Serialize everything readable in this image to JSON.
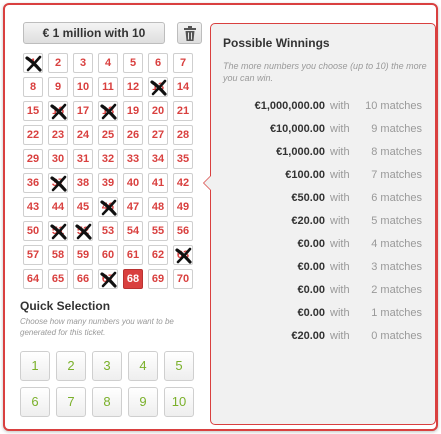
{
  "stake_button": {
    "label": "€ 1 million with 10"
  },
  "icons": {
    "trash": "trash-icon",
    "selected_mark": "x-mark-icon"
  },
  "colors": {
    "accent": "#d9403f",
    "quick_number": "#7ab02a",
    "panel_bg": "#f1f1f1"
  },
  "numbers": [
    {
      "n": "1",
      "state": "crossed"
    },
    {
      "n": "2",
      "state": "normal"
    },
    {
      "n": "3",
      "state": "normal"
    },
    {
      "n": "4",
      "state": "normal"
    },
    {
      "n": "5",
      "state": "normal"
    },
    {
      "n": "6",
      "state": "normal"
    },
    {
      "n": "7",
      "state": "normal"
    },
    {
      "n": "8",
      "state": "normal"
    },
    {
      "n": "9",
      "state": "normal"
    },
    {
      "n": "10",
      "state": "normal"
    },
    {
      "n": "11",
      "state": "normal"
    },
    {
      "n": "12",
      "state": "normal"
    },
    {
      "n": "13",
      "state": "crossed"
    },
    {
      "n": "14",
      "state": "normal"
    },
    {
      "n": "15",
      "state": "normal"
    },
    {
      "n": "16",
      "state": "crossed"
    },
    {
      "n": "17",
      "state": "normal"
    },
    {
      "n": "18",
      "state": "crossed"
    },
    {
      "n": "19",
      "state": "normal"
    },
    {
      "n": "20",
      "state": "normal"
    },
    {
      "n": "21",
      "state": "normal"
    },
    {
      "n": "22",
      "state": "normal"
    },
    {
      "n": "23",
      "state": "normal"
    },
    {
      "n": "24",
      "state": "normal"
    },
    {
      "n": "25",
      "state": "normal"
    },
    {
      "n": "26",
      "state": "normal"
    },
    {
      "n": "27",
      "state": "normal"
    },
    {
      "n": "28",
      "state": "normal"
    },
    {
      "n": "29",
      "state": "normal"
    },
    {
      "n": "30",
      "state": "normal"
    },
    {
      "n": "31",
      "state": "normal"
    },
    {
      "n": "32",
      "state": "normal"
    },
    {
      "n": "33",
      "state": "normal"
    },
    {
      "n": "34",
      "state": "normal"
    },
    {
      "n": "35",
      "state": "normal"
    },
    {
      "n": "36",
      "state": "normal"
    },
    {
      "n": "37",
      "state": "crossed"
    },
    {
      "n": "38",
      "state": "normal"
    },
    {
      "n": "39",
      "state": "normal"
    },
    {
      "n": "40",
      "state": "normal"
    },
    {
      "n": "41",
      "state": "normal"
    },
    {
      "n": "42",
      "state": "normal"
    },
    {
      "n": "43",
      "state": "normal"
    },
    {
      "n": "44",
      "state": "normal"
    },
    {
      "n": "45",
      "state": "normal"
    },
    {
      "n": "46",
      "state": "crossed"
    },
    {
      "n": "47",
      "state": "normal"
    },
    {
      "n": "48",
      "state": "normal"
    },
    {
      "n": "49",
      "state": "normal"
    },
    {
      "n": "50",
      "state": "normal"
    },
    {
      "n": "51",
      "state": "crossed"
    },
    {
      "n": "52",
      "state": "crossed"
    },
    {
      "n": "53",
      "state": "normal"
    },
    {
      "n": "54",
      "state": "normal"
    },
    {
      "n": "55",
      "state": "normal"
    },
    {
      "n": "56",
      "state": "normal"
    },
    {
      "n": "57",
      "state": "normal"
    },
    {
      "n": "58",
      "state": "normal"
    },
    {
      "n": "59",
      "state": "normal"
    },
    {
      "n": "60",
      "state": "normal"
    },
    {
      "n": "61",
      "state": "normal"
    },
    {
      "n": "62",
      "state": "normal"
    },
    {
      "n": "63",
      "state": "crossed"
    },
    {
      "n": "64",
      "state": "normal"
    },
    {
      "n": "65",
      "state": "normal"
    },
    {
      "n": "66",
      "state": "normal"
    },
    {
      "n": "67",
      "state": "crossed"
    },
    {
      "n": "68",
      "state": "selected"
    },
    {
      "n": "69",
      "state": "normal"
    },
    {
      "n": "70",
      "state": "normal"
    }
  ],
  "quick_selection": {
    "title": "Quick Selection",
    "description": "Choose how many numbers you want to be generated for this ticket.",
    "options": [
      "1",
      "2",
      "3",
      "4",
      "5",
      "6",
      "7",
      "8",
      "9",
      "10"
    ]
  },
  "possible_winnings": {
    "title": "Possible Winnings",
    "description": "The more numbers you choose (up to 10) the more you can win.",
    "rows": [
      {
        "amount": "€1,000,000.00",
        "with": "with",
        "matches": "10 matches"
      },
      {
        "amount": "€10,000.00",
        "with": "with",
        "matches": "9 matches"
      },
      {
        "amount": "€1,000.00",
        "with": "with",
        "matches": "8 matches"
      },
      {
        "amount": "€100.00",
        "with": "with",
        "matches": "7 matches"
      },
      {
        "amount": "€50.00",
        "with": "with",
        "matches": "6 matches"
      },
      {
        "amount": "€20.00",
        "with": "with",
        "matches": "5 matches"
      },
      {
        "amount": "€0.00",
        "with": "with",
        "matches": "4 matches"
      },
      {
        "amount": "€0.00",
        "with": "with",
        "matches": "3 matches"
      },
      {
        "amount": "€0.00",
        "with": "with",
        "matches": "2 matches"
      },
      {
        "amount": "€0.00",
        "with": "with",
        "matches": "1 matches"
      },
      {
        "amount": "€20.00",
        "with": "with",
        "matches": "0 matches"
      }
    ]
  }
}
